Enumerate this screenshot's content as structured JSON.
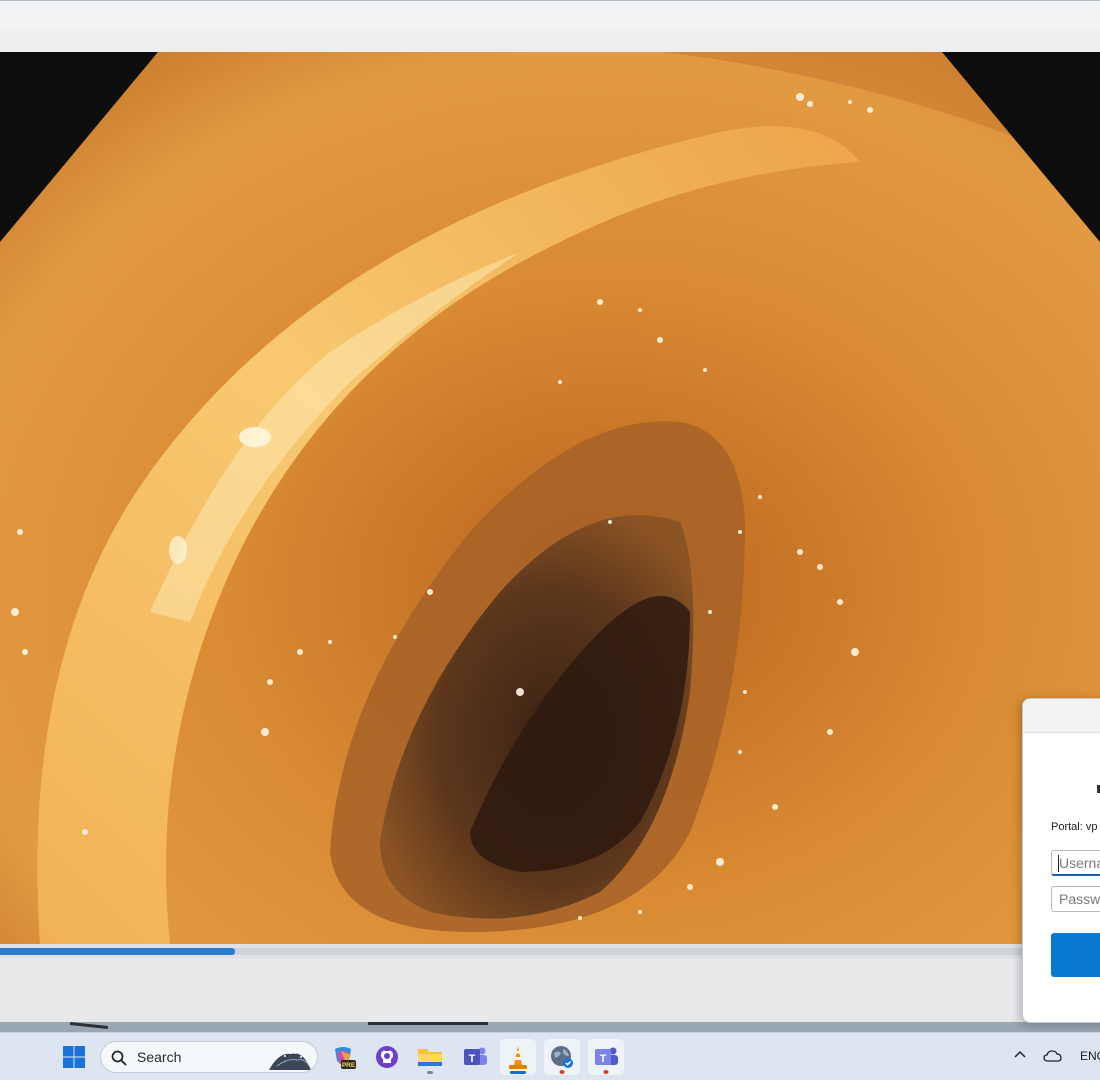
{
  "window": {
    "progress_fraction": 0.214
  },
  "vpn_dialog": {
    "portal_label": "Portal: vp",
    "username_placeholder": "Userna",
    "password_placeholder": "Passwo"
  },
  "taskbar": {
    "search_placeholder": "Search",
    "apps": [
      {
        "name": "start-button-icon"
      },
      {
        "name": "copilot-pre-icon",
        "badge": "PRE"
      },
      {
        "name": "github-desktop-icon"
      },
      {
        "name": "file-explorer-icon"
      },
      {
        "name": "teams-classic-icon"
      },
      {
        "name": "vlc-player-icon"
      },
      {
        "name": "vpn-globe-icon"
      },
      {
        "name": "teams-icon"
      }
    ],
    "tray": {
      "language": "ENG"
    }
  },
  "colors": {
    "accent": "#0a78d0",
    "progress": "#2e7ad1",
    "taskbar": "#dde6f0"
  }
}
